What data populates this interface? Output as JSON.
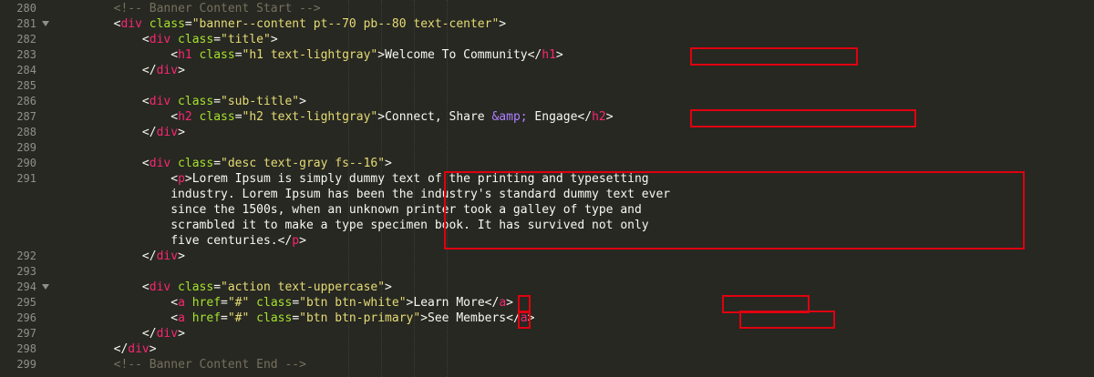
{
  "editor": {
    "lines": [
      {
        "n": "280",
        "fold": false,
        "indent": "        ",
        "parts": [
          {
            "c": "cm",
            "t": "<!-- Banner Content Start -->"
          }
        ]
      },
      {
        "n": "281",
        "fold": true,
        "indent": "        ",
        "parts": [
          {
            "c": "t",
            "t": "<"
          },
          {
            "c": "tag",
            "t": "div"
          },
          {
            "c": "attr",
            "t": " class"
          },
          {
            "c": "t",
            "t": "="
          },
          {
            "c": "str",
            "t": "\"banner--content pt--70 pb--80 text-center\""
          },
          {
            "c": "t",
            "t": ">"
          }
        ]
      },
      {
        "n": "282",
        "fold": false,
        "indent": "            ",
        "parts": [
          {
            "c": "t",
            "t": "<"
          },
          {
            "c": "tag",
            "t": "div"
          },
          {
            "c": "attr",
            "t": " class"
          },
          {
            "c": "t",
            "t": "="
          },
          {
            "c": "str",
            "t": "\"title\""
          },
          {
            "c": "t",
            "t": ">"
          }
        ]
      },
      {
        "n": "283",
        "fold": false,
        "indent": "                ",
        "parts": [
          {
            "c": "t",
            "t": "<"
          },
          {
            "c": "tag",
            "t": "h1"
          },
          {
            "c": "attr",
            "t": " class"
          },
          {
            "c": "t",
            "t": "="
          },
          {
            "c": "str",
            "t": "\"h1 text-lightgray\""
          },
          {
            "c": "t",
            "t": ">"
          },
          {
            "c": "t",
            "t": "Welcome To Community"
          },
          {
            "c": "t",
            "t": "</"
          },
          {
            "c": "tag",
            "t": "h1"
          },
          {
            "c": "t",
            "t": ">"
          }
        ]
      },
      {
        "n": "284",
        "fold": false,
        "indent": "            ",
        "parts": [
          {
            "c": "t",
            "t": "</"
          },
          {
            "c": "tag",
            "t": "div"
          },
          {
            "c": "t",
            "t": ">"
          }
        ]
      },
      {
        "n": "285",
        "fold": false,
        "indent": "",
        "parts": []
      },
      {
        "n": "286",
        "fold": false,
        "indent": "            ",
        "parts": [
          {
            "c": "t",
            "t": "<"
          },
          {
            "c": "tag",
            "t": "div"
          },
          {
            "c": "attr",
            "t": " class"
          },
          {
            "c": "t",
            "t": "="
          },
          {
            "c": "str",
            "t": "\"sub-title\""
          },
          {
            "c": "t",
            "t": ">"
          }
        ]
      },
      {
        "n": "287",
        "fold": false,
        "indent": "                ",
        "parts": [
          {
            "c": "t",
            "t": "<"
          },
          {
            "c": "tag",
            "t": "h2"
          },
          {
            "c": "attr",
            "t": " class"
          },
          {
            "c": "t",
            "t": "="
          },
          {
            "c": "str",
            "t": "\"h2 text-lightgray\""
          },
          {
            "c": "t",
            "t": ">"
          },
          {
            "c": "t",
            "t": "Connect, Share "
          },
          {
            "c": "ent",
            "t": "&amp;"
          },
          {
            "c": "t",
            "t": " Engage"
          },
          {
            "c": "t",
            "t": "</"
          },
          {
            "c": "tag",
            "t": "h2"
          },
          {
            "c": "t",
            "t": ">"
          }
        ]
      },
      {
        "n": "288",
        "fold": false,
        "indent": "            ",
        "parts": [
          {
            "c": "t",
            "t": "</"
          },
          {
            "c": "tag",
            "t": "div"
          },
          {
            "c": "t",
            "t": ">"
          }
        ]
      },
      {
        "n": "289",
        "fold": false,
        "indent": "",
        "parts": []
      },
      {
        "n": "290",
        "fold": false,
        "indent": "            ",
        "parts": [
          {
            "c": "t",
            "t": "<"
          },
          {
            "c": "tag",
            "t": "div"
          },
          {
            "c": "attr",
            "t": " class"
          },
          {
            "c": "t",
            "t": "="
          },
          {
            "c": "str",
            "t": "\"desc text-gray fs--16\""
          },
          {
            "c": "t",
            "t": ">"
          }
        ]
      },
      {
        "n": "291",
        "fold": false,
        "indent": "                ",
        "parts": [
          {
            "c": "t",
            "t": "<"
          },
          {
            "c": "tag",
            "t": "p"
          },
          {
            "c": "t",
            "t": ">Lorem Ipsum is simply dummy text of the printing and typesetting"
          }
        ]
      },
      {
        "n": "",
        "fold": false,
        "indent": "                ",
        "parts": [
          {
            "c": "t",
            "t": "industry. Lorem Ipsum has been the industry's standard dummy text ever"
          }
        ]
      },
      {
        "n": "",
        "fold": false,
        "indent": "                ",
        "parts": [
          {
            "c": "t",
            "t": "since the 1500s, when an unknown printer took a galley of type and"
          }
        ]
      },
      {
        "n": "",
        "fold": false,
        "indent": "                ",
        "parts": [
          {
            "c": "t",
            "t": "scrambled it to make a type specimen book. It has survived not only"
          }
        ]
      },
      {
        "n": "",
        "fold": false,
        "indent": "                ",
        "parts": [
          {
            "c": "t",
            "t": "five centuries.</"
          },
          {
            "c": "tag",
            "t": "p"
          },
          {
            "c": "t",
            "t": ">"
          }
        ]
      },
      {
        "n": "292",
        "fold": false,
        "indent": "            ",
        "parts": [
          {
            "c": "t",
            "t": "</"
          },
          {
            "c": "tag",
            "t": "div"
          },
          {
            "c": "t",
            "t": ">"
          }
        ]
      },
      {
        "n": "293",
        "fold": false,
        "indent": "",
        "parts": []
      },
      {
        "n": "294",
        "fold": true,
        "indent": "            ",
        "parts": [
          {
            "c": "t",
            "t": "<"
          },
          {
            "c": "tag",
            "t": "div"
          },
          {
            "c": "attr",
            "t": " class"
          },
          {
            "c": "t",
            "t": "="
          },
          {
            "c": "str",
            "t": "\"action text-uppercase\""
          },
          {
            "c": "t",
            "t": ">"
          }
        ]
      },
      {
        "n": "295",
        "fold": false,
        "indent": "                ",
        "parts": [
          {
            "c": "t",
            "t": "<"
          },
          {
            "c": "tag",
            "t": "a"
          },
          {
            "c": "attr",
            "t": " href"
          },
          {
            "c": "t",
            "t": "="
          },
          {
            "c": "str",
            "t": "\"#\""
          },
          {
            "c": "attr",
            "t": " class"
          },
          {
            "c": "t",
            "t": "="
          },
          {
            "c": "str",
            "t": "\"btn btn-white\""
          },
          {
            "c": "t",
            "t": ">"
          },
          {
            "c": "t",
            "t": "Learn More"
          },
          {
            "c": "t",
            "t": "</"
          },
          {
            "c": "tag",
            "t": "a"
          },
          {
            "c": "t",
            "t": ">"
          }
        ]
      },
      {
        "n": "296",
        "fold": false,
        "indent": "                ",
        "parts": [
          {
            "c": "t",
            "t": "<"
          },
          {
            "c": "tag",
            "t": "a"
          },
          {
            "c": "attr",
            "t": " href"
          },
          {
            "c": "t",
            "t": "="
          },
          {
            "c": "str",
            "t": "\"#\""
          },
          {
            "c": "attr",
            "t": " class"
          },
          {
            "c": "t",
            "t": "="
          },
          {
            "c": "str",
            "t": "\"btn btn-primary\""
          },
          {
            "c": "t",
            "t": ">"
          },
          {
            "c": "t",
            "t": "See Members"
          },
          {
            "c": "t",
            "t": "</"
          },
          {
            "c": "tag",
            "t": "a"
          },
          {
            "c": "t",
            "t": ">"
          }
        ]
      },
      {
        "n": "297",
        "fold": false,
        "indent": "            ",
        "parts": [
          {
            "c": "t",
            "t": "</"
          },
          {
            "c": "tag",
            "t": "div"
          },
          {
            "c": "t",
            "t": ">"
          }
        ]
      },
      {
        "n": "298",
        "fold": false,
        "indent": "        ",
        "parts": [
          {
            "c": "t",
            "t": "</"
          },
          {
            "c": "tag",
            "t": "div"
          },
          {
            "c": "t",
            "t": ">"
          }
        ]
      },
      {
        "n": "299",
        "fold": false,
        "indent": "        ",
        "parts": [
          {
            "c": "cm",
            "t": "<!-- Banner Content End -->"
          }
        ]
      }
    ]
  },
  "colors": {
    "background": "#272822",
    "tag": "#f92672",
    "attribute": "#a6e22e",
    "string": "#e6db74",
    "entity": "#ae81ff",
    "comment": "#75715e",
    "highlight": "#e0000f"
  }
}
